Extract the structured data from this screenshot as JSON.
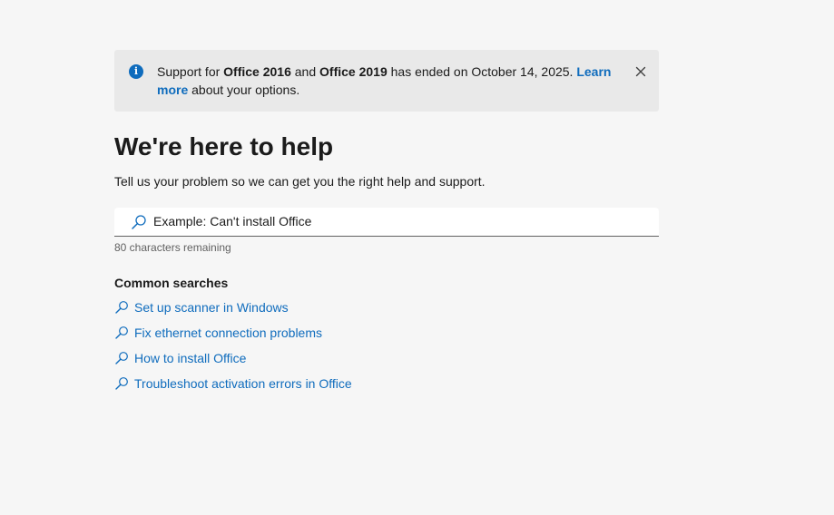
{
  "banner": {
    "text_1": "Support for ",
    "product_1": "Office 2016",
    "text_2": " and ",
    "product_2": "Office 2019",
    "text_3": " has ended on October 14, 2025. ",
    "link_label": "Learn more",
    "text_4": " about your options.",
    "icon": "info-icon",
    "close_icon": "close-icon"
  },
  "header": {
    "title": "We're here to help",
    "subtitle": "Tell us your problem so we can get you the right help and support."
  },
  "search": {
    "placeholder": "Example: Can't install Office",
    "value": "",
    "icon": "search-icon",
    "char_count": "80 characters remaining"
  },
  "common_searches": {
    "heading": "Common searches",
    "items": [
      {
        "label": "Set up scanner in Windows",
        "icon": "search-icon"
      },
      {
        "label": "Fix ethernet connection problems",
        "icon": "search-icon"
      },
      {
        "label": "How to install Office",
        "icon": "search-icon"
      },
      {
        "label": "Troubleshoot activation errors in Office",
        "icon": "search-icon"
      }
    ]
  },
  "colors": {
    "accent": "#0f6cbd",
    "background": "#f6f6f6",
    "banner_background": "#e9e9e9",
    "text": "#1b1b1b",
    "muted_text": "#616161"
  }
}
